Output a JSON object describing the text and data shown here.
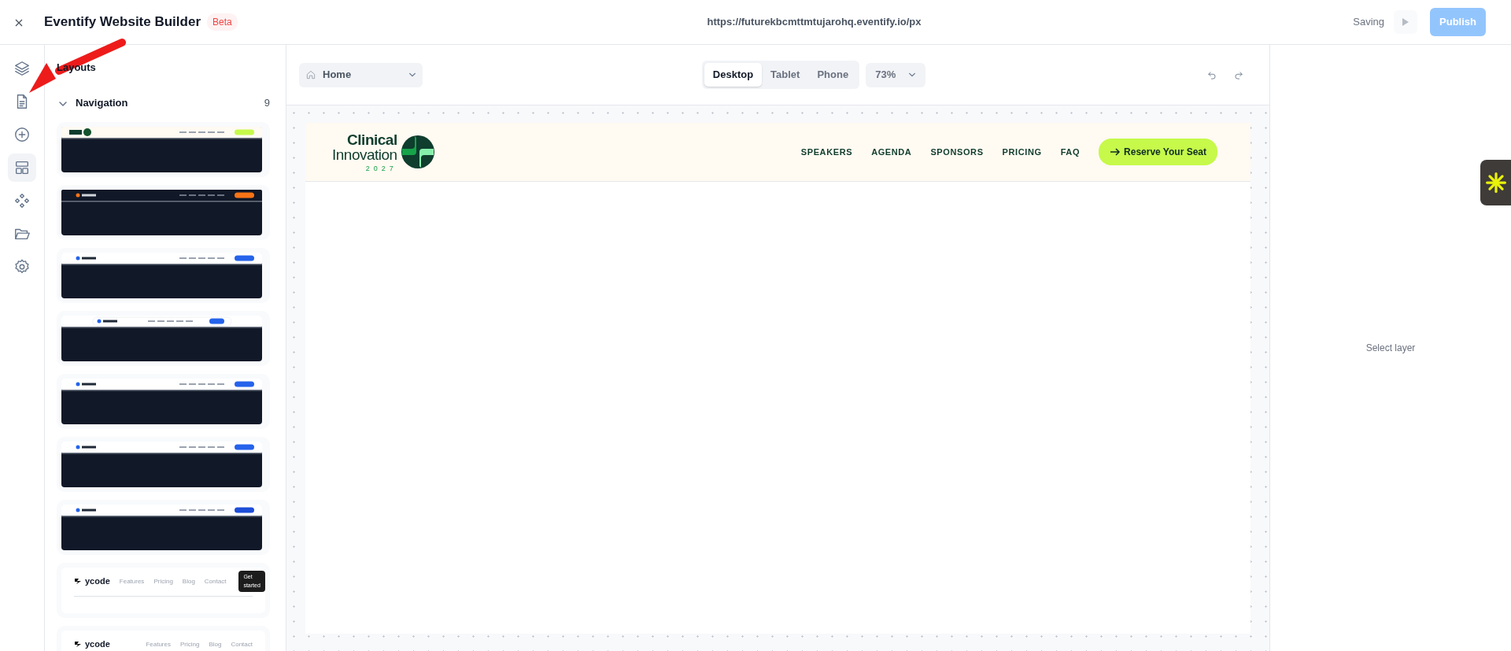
{
  "app": {
    "title": "Eventify Website Builder",
    "badge": "Beta",
    "url": "https://futurekbcmttmtujarohq.eventify.io/px",
    "save_status": "Saving",
    "publish": "Publish"
  },
  "rail": [
    {
      "kind": "layers",
      "selected": false
    },
    {
      "kind": "page",
      "selected": false
    },
    {
      "kind": "plus",
      "selected": false
    },
    {
      "kind": "layout",
      "selected": true
    },
    {
      "kind": "components",
      "selected": false
    },
    {
      "kind": "folder",
      "selected": false
    },
    {
      "kind": "gear",
      "selected": false
    }
  ],
  "panel": {
    "title": "Layouts",
    "section": {
      "label": "Navigation",
      "count": "9",
      "expanded": true,
      "templates": [
        {
          "kind": "cream",
          "color": "#c6f94a"
        },
        {
          "kind": "dark",
          "color": "#f97316"
        },
        {
          "kind": "light",
          "color": "#2563eb"
        },
        {
          "kind": "floating",
          "color": "#2563eb"
        },
        {
          "kind": "light",
          "color": "#2563eb"
        },
        {
          "kind": "light",
          "color": "#2563eb"
        },
        {
          "kind": "light",
          "color": "#1d4ed8"
        },
        {
          "kind": "text",
          "brand": "ycode",
          "links": [
            "Features",
            "Pricing",
            "Blog",
            "Contact"
          ],
          "cta": "Get started"
        },
        {
          "kind": "text",
          "brand": "ycode",
          "links": [
            "Features",
            "Pricing",
            "Blog",
            "Contact"
          ]
        }
      ]
    }
  },
  "toolbar": {
    "page": "Home",
    "devices": [
      {
        "label": "Desktop",
        "selected": true
      },
      {
        "label": "Tablet",
        "selected": false
      },
      {
        "label": "Phone",
        "selected": false
      }
    ],
    "zoom": "73%"
  },
  "canvas": {
    "brand_top": "Clinical",
    "brand_main": "Innovation",
    "brand_year": "2027",
    "links": [
      "SPEAKERS",
      "AGENDA",
      "SPONSORS",
      "PRICING",
      "FAQ"
    ],
    "cta": "Reserve Your Seat"
  },
  "inspector": {
    "empty": "Select layer"
  }
}
